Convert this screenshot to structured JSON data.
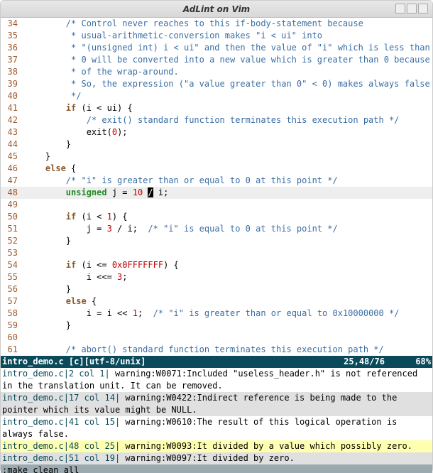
{
  "window": {
    "title": "AdLint on Vim"
  },
  "statusline": {
    "left": "intro_demo.c [c][utf-8/unix]",
    "pos": "25,48/76",
    "pct": "68%"
  },
  "cmdline": ":make clean all",
  "code": {
    "start": 34,
    "cursor_line": 48,
    "cursor_before": "        unsigned j = 10 ",
    "cursor_char": "/",
    "cursor_after": " i;",
    "lines": [
      {
        "n": 34,
        "segs": [
          {
            "c": "cmt",
            "t": "        /* Control never reaches to this if-body-statement because"
          }
        ]
      },
      {
        "n": 35,
        "segs": [
          {
            "c": "cmt",
            "t": "         * usual-arithmetic-conversion makes \"i < ui\" into"
          }
        ]
      },
      {
        "n": 36,
        "segs": [
          {
            "c": "cmt",
            "t": "         * \"(unsigned int) i < ui\" and then the value of \"i\" which is less than"
          }
        ]
      },
      {
        "n": 37,
        "segs": [
          {
            "c": "cmt",
            "t": "         * 0 will be converted into a new value which is greater than 0 because"
          }
        ]
      },
      {
        "n": 38,
        "segs": [
          {
            "c": "cmt",
            "t": "         * of the wrap-around."
          }
        ]
      },
      {
        "n": 39,
        "segs": [
          {
            "c": "cmt",
            "t": "         * So, the expression (\"a value greater than 0\" < 0) makes always false"
          }
        ]
      },
      {
        "n": 40,
        "segs": [
          {
            "c": "cmt",
            "t": "         */"
          }
        ]
      },
      {
        "n": 41,
        "segs": [
          {
            "c": "",
            "t": "        "
          },
          {
            "c": "kw",
            "t": "if"
          },
          {
            "c": "",
            "t": " (i < ui) {"
          }
        ]
      },
      {
        "n": 42,
        "segs": [
          {
            "c": "",
            "t": "            "
          },
          {
            "c": "cmt",
            "t": "/* exit() standard function terminates this execution path */"
          }
        ]
      },
      {
        "n": 43,
        "segs": [
          {
            "c": "",
            "t": "            exit("
          },
          {
            "c": "num",
            "t": "0"
          },
          {
            "c": "",
            "t": ");"
          }
        ]
      },
      {
        "n": 44,
        "segs": [
          {
            "c": "",
            "t": "        }"
          }
        ]
      },
      {
        "n": 45,
        "segs": [
          {
            "c": "",
            "t": "    }"
          }
        ]
      },
      {
        "n": 46,
        "segs": [
          {
            "c": "",
            "t": "    "
          },
          {
            "c": "kw",
            "t": "else"
          },
          {
            "c": "",
            "t": " {"
          }
        ]
      },
      {
        "n": 47,
        "segs": [
          {
            "c": "",
            "t": "        "
          },
          {
            "c": "cmt",
            "t": "/* \"i\" is greater than or equal to 0 at this point */"
          }
        ]
      },
      {
        "n": 48,
        "segs": []
      },
      {
        "n": 49,
        "segs": [
          {
            "c": "",
            "t": ""
          }
        ]
      },
      {
        "n": 50,
        "segs": [
          {
            "c": "",
            "t": "        "
          },
          {
            "c": "kw",
            "t": "if"
          },
          {
            "c": "",
            "t": " (i < "
          },
          {
            "c": "num",
            "t": "1"
          },
          {
            "c": "",
            "t": ") {"
          }
        ]
      },
      {
        "n": 51,
        "segs": [
          {
            "c": "",
            "t": "            j = "
          },
          {
            "c": "num",
            "t": "3"
          },
          {
            "c": "",
            "t": " / i;  "
          },
          {
            "c": "cmt",
            "t": "/* \"i\" is equal to 0 at this point */"
          }
        ]
      },
      {
        "n": 52,
        "segs": [
          {
            "c": "",
            "t": "        }"
          }
        ]
      },
      {
        "n": 53,
        "segs": [
          {
            "c": "",
            "t": ""
          }
        ]
      },
      {
        "n": 54,
        "segs": [
          {
            "c": "",
            "t": "        "
          },
          {
            "c": "kw",
            "t": "if"
          },
          {
            "c": "",
            "t": " (i <= "
          },
          {
            "c": "num",
            "t": "0x0FFFFFFF"
          },
          {
            "c": "",
            "t": ") {"
          }
        ]
      },
      {
        "n": 55,
        "segs": [
          {
            "c": "",
            "t": "            i <<= "
          },
          {
            "c": "num",
            "t": "3"
          },
          {
            "c": "",
            "t": ";"
          }
        ]
      },
      {
        "n": 56,
        "segs": [
          {
            "c": "",
            "t": "        }"
          }
        ]
      },
      {
        "n": 57,
        "segs": [
          {
            "c": "",
            "t": "        "
          },
          {
            "c": "kw",
            "t": "else"
          },
          {
            "c": "",
            "t": " {"
          }
        ]
      },
      {
        "n": 58,
        "segs": [
          {
            "c": "",
            "t": "            i = i << "
          },
          {
            "c": "num",
            "t": "1"
          },
          {
            "c": "",
            "t": ";  "
          },
          {
            "c": "cmt",
            "t": "/* \"i\" is greater than or equal to 0x10000000 */"
          }
        ]
      },
      {
        "n": 59,
        "segs": [
          {
            "c": "",
            "t": "        }"
          }
        ]
      },
      {
        "n": 60,
        "segs": [
          {
            "c": "",
            "t": ""
          }
        ]
      },
      {
        "n": 61,
        "segs": [
          {
            "c": "",
            "t": "        "
          },
          {
            "c": "cmt",
            "t": "/* abort() standard function terminates this execution path */"
          }
        ]
      }
    ]
  },
  "quickfix": [
    {
      "sel": false,
      "alt": false,
      "loc": "intro_demo.c|2 col 1|",
      "msg": " warning:W0071:Included \"useless_header.h\" is not referenced in the translation unit. It can be removed."
    },
    {
      "sel": false,
      "alt": true,
      "loc": "intro_demo.c|17 col 14|",
      "msg": " warning:W0422:Indirect reference is being made to the pointer which its value might be NULL."
    },
    {
      "sel": false,
      "alt": false,
      "loc": "intro_demo.c|41 col 15|",
      "msg": " warning:W0610:The result of this logical operation is always false."
    },
    {
      "sel": true,
      "alt": false,
      "loc": "intro_demo.c|48 col 25|",
      "msg": " warning:W0093:It divided by a value which possibly zero."
    },
    {
      "sel": false,
      "alt": true,
      "loc": "intro_demo.c|51 col 19|",
      "msg": " warning:W0097:It divided by zero."
    }
  ]
}
